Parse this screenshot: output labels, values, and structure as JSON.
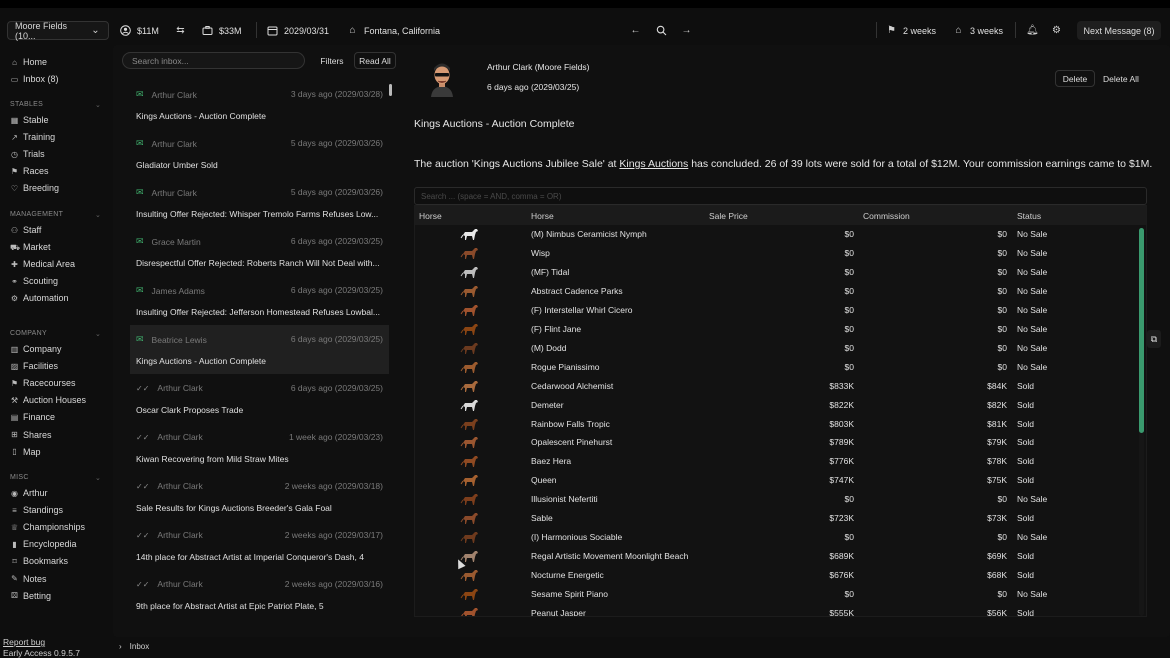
{
  "toolbar": {
    "stable_name": "Moore Fields (10...",
    "player_money": "$11M",
    "stable_money": "$33M",
    "date": "2029/03/31",
    "location": "Fontana, California",
    "flag_time": "2 weeks",
    "home_time": "3 weeks",
    "next_message": "Next Message (8)"
  },
  "sidebar": {
    "top": [
      {
        "label": "Home",
        "icon": "home-icon"
      },
      {
        "label": "Inbox (8)",
        "icon": "inbox-icon"
      }
    ],
    "sections": [
      {
        "title": "STABLES",
        "items": [
          {
            "label": "Stable",
            "icon": "grid-icon"
          },
          {
            "label": "Training",
            "icon": "trend-icon"
          },
          {
            "label": "Trials",
            "icon": "timer-icon"
          },
          {
            "label": "Races",
            "icon": "flag-icon"
          },
          {
            "label": "Breeding",
            "icon": "heart-icon"
          }
        ]
      },
      {
        "title": "MANAGEMENT",
        "items": [
          {
            "label": "Staff",
            "icon": "people-icon"
          },
          {
            "label": "Market",
            "icon": "cart-icon"
          },
          {
            "label": "Medical Area",
            "icon": "medical-icon"
          },
          {
            "label": "Scouting",
            "icon": "binoculars-icon"
          },
          {
            "label": "Automation",
            "icon": "gear-icon"
          }
        ]
      },
      {
        "title": "COMPANY",
        "items": [
          {
            "label": "Company",
            "icon": "building-icon"
          },
          {
            "label": "Facilities",
            "icon": "image-icon"
          },
          {
            "label": "Racecourses",
            "icon": "flag-icon"
          },
          {
            "label": "Auction Houses",
            "icon": "gavel-icon"
          },
          {
            "label": "Finance",
            "icon": "finance-icon"
          },
          {
            "label": "Shares",
            "icon": "shares-icon"
          },
          {
            "label": "Map",
            "icon": "map-icon"
          }
        ]
      },
      {
        "title": "MISC",
        "items": [
          {
            "label": "Arthur",
            "icon": "person-icon"
          },
          {
            "label": "Standings",
            "icon": "standings-icon"
          },
          {
            "label": "Championships",
            "icon": "trophy-icon"
          },
          {
            "label": "Encyclopedia",
            "icon": "book-icon"
          },
          {
            "label": "Bookmarks",
            "icon": "bookmark-icon"
          },
          {
            "label": "Notes",
            "icon": "notes-icon"
          },
          {
            "label": "Betting",
            "icon": "betting-icon"
          }
        ]
      }
    ],
    "report_bug": "Report bug",
    "version": "Early Access 0.9.5.7"
  },
  "inbox": {
    "search_placeholder": "Search inbox...",
    "filters_label": "Filters",
    "read_all_label": "Read All",
    "messages": [
      {
        "sender": "Arthur Clark",
        "time": "3 days ago (2029/03/28)",
        "subject": "Kings Auctions - Auction Complete",
        "unread": true
      },
      {
        "sender": "Arthur Clark",
        "time": "5 days ago (2029/03/26)",
        "subject": "Gladiator Umber Sold",
        "unread": true
      },
      {
        "sender": "Arthur Clark",
        "time": "5 days ago (2029/03/26)",
        "subject": "Insulting Offer Rejected: Whisper Tremolo Farms Refuses Low...",
        "unread": true
      },
      {
        "sender": "Grace Martin",
        "time": "6 days ago (2029/03/25)",
        "subject": "Disrespectful Offer Rejected: Roberts Ranch Will Not Deal with...",
        "unread": true
      },
      {
        "sender": "James Adams",
        "time": "6 days ago (2029/03/25)",
        "subject": "Insulting Offer Rejected: Jefferson Homestead Refuses Lowbal...",
        "unread": true
      },
      {
        "sender": "Beatrice Lewis",
        "time": "6 days ago (2029/03/25)",
        "subject": "Kings Auctions - Auction Complete",
        "unread": true
      },
      {
        "sender": "Arthur Clark",
        "time": "6 days ago (2029/03/25)",
        "subject": "Oscar Clark Proposes Trade",
        "unread": false
      },
      {
        "sender": "Arthur Clark",
        "time": "1 week ago (2029/03/23)",
        "subject": "Kiwan Recovering from Mild Straw Mites",
        "unread": false
      },
      {
        "sender": "Arthur Clark",
        "time": "2 weeks ago (2029/03/18)",
        "subject": "Sale Results for Kings Auctions Breeder's Gala Foal",
        "unread": false
      },
      {
        "sender": "Arthur Clark",
        "time": "2 weeks ago (2029/03/17)",
        "subject": "14th place for Abstract Artist at Imperial Conqueror's Dash, 4",
        "unread": false
      },
      {
        "sender": "Arthur Clark",
        "time": "2 weeks ago (2029/03/16)",
        "subject": "9th place for Abstract Artist at Epic Patriot Plate, 5",
        "unread": false
      }
    ]
  },
  "detail": {
    "sender": "Arthur Clark (Moore Fields)",
    "date": "6 days ago (2029/03/25)",
    "delete_label": "Delete",
    "delete_all_label": "Delete All",
    "subject": "Kings Auctions - Auction Complete",
    "body_pre": "The auction 'Kings Auctions Jubilee Sale' at ",
    "body_link": "Kings Auctions",
    "body_post": " has concluded. 26 of 39 lots were sold for a total of $12M. Your commission earnings came to $1M.",
    "table_search_placeholder": "Search ... (space = AND, comma = OR)",
    "columns": {
      "horse_icon": "Horse",
      "horse": "Horse",
      "sale_price": "Sale Price",
      "commission": "Commission",
      "status": "Status"
    },
    "rows": [
      {
        "name": "(M) Nimbus Ceramicist Nymph",
        "price": "$0",
        "commission": "$0",
        "status": "No Sale",
        "coat": "#e8e8e8"
      },
      {
        "name": "Wisp",
        "price": "$0",
        "commission": "$0",
        "status": "No Sale",
        "coat": "#8a4a2a"
      },
      {
        "name": "(MF) Tidal",
        "price": "$0",
        "commission": "$0",
        "status": "No Sale",
        "coat": "#bdbdbd"
      },
      {
        "name": "Abstract Cadence Parks",
        "price": "$0",
        "commission": "$0",
        "status": "No Sale",
        "coat": "#9a5a30"
      },
      {
        "name": "(F) Interstellar Whirl Cicero",
        "price": "$0",
        "commission": "$0",
        "status": "No Sale",
        "coat": "#a0522d"
      },
      {
        "name": "(F) Flint Jane",
        "price": "$0",
        "commission": "$0",
        "status": "No Sale",
        "coat": "#8b4513"
      },
      {
        "name": "(M) Dodd",
        "price": "$0",
        "commission": "$0",
        "status": "No Sale",
        "coat": "#6b3a1f"
      },
      {
        "name": "Rogue Pianissimo",
        "price": "$0",
        "commission": "$0",
        "status": "No Sale",
        "coat": "#9c5b2e"
      },
      {
        "name": "Cedarwood Alchemist",
        "price": "$833K",
        "commission": "$84K",
        "status": "Sold",
        "coat": "#a86a3d"
      },
      {
        "name": "Demeter",
        "price": "$822K",
        "commission": "$82K",
        "status": "Sold",
        "coat": "#d9d9d9"
      },
      {
        "name": "Rainbow Falls Tropic",
        "price": "$803K",
        "commission": "$81K",
        "status": "Sold",
        "coat": "#7a3f1d"
      },
      {
        "name": "Opalescent Pinehurst",
        "price": "$789K",
        "commission": "$79K",
        "status": "Sold",
        "coat": "#9a5630"
      },
      {
        "name": "Baez Hera",
        "price": "$776K",
        "commission": "$78K",
        "status": "Sold",
        "coat": "#8f4a22"
      },
      {
        "name": "Queen",
        "price": "$747K",
        "commission": "$75K",
        "status": "Sold",
        "coat": "#a5602f"
      },
      {
        "name": "Illusionist Nefertiti",
        "price": "$0",
        "commission": "$0",
        "status": "No Sale",
        "coat": "#7d3e1c"
      },
      {
        "name": "Sable",
        "price": "$723K",
        "commission": "$73K",
        "status": "Sold",
        "coat": "#8a4a2a"
      },
      {
        "name": "(I) Harmonious Sociable",
        "price": "$0",
        "commission": "$0",
        "status": "No Sale",
        "coat": "#6e3a1d"
      },
      {
        "name": "Regal Artistic Movement Moonlight Beach",
        "price": "$689K",
        "commission": "$69K",
        "status": "Sold",
        "coat": "#a0826d"
      },
      {
        "name": "Nocturne Energetic",
        "price": "$676K",
        "commission": "$68K",
        "status": "Sold",
        "coat": "#9a5a30"
      },
      {
        "name": "Sesame Spirit Piano",
        "price": "$0",
        "commission": "$0",
        "status": "No Sale",
        "coat": "#8b4513"
      },
      {
        "name": "Peanut Jasper",
        "price": "$555K",
        "commission": "$56K",
        "status": "Sold",
        "coat": "#a0522d"
      }
    ]
  },
  "footer": {
    "breadcrumb": "Inbox"
  },
  "colors": {
    "accent_green": "#3fae6c",
    "background": "#0e0e0e"
  }
}
